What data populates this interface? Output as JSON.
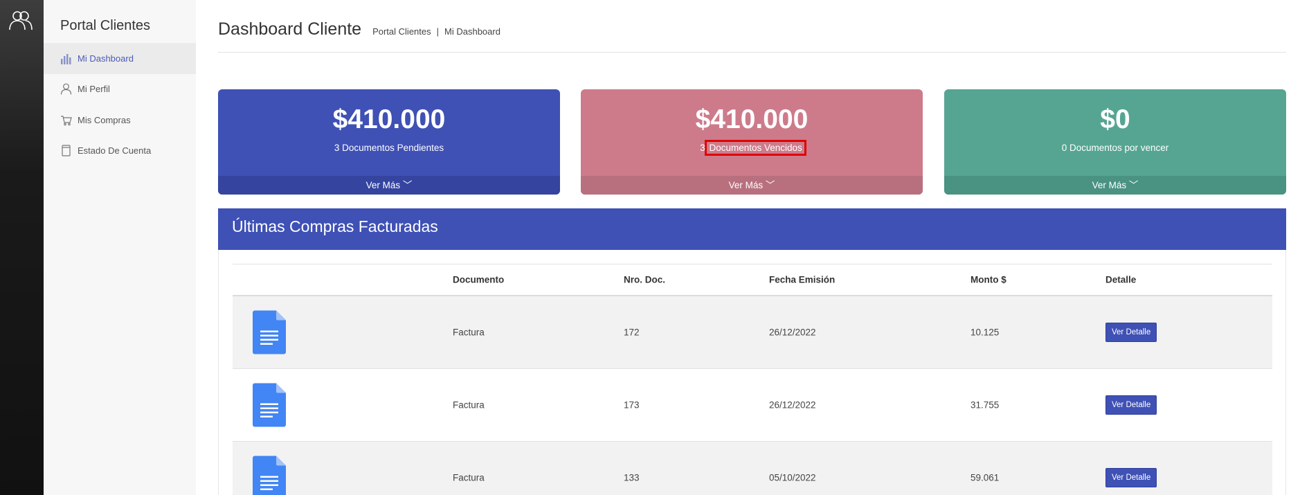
{
  "app": {
    "brand": "Portal Clientes"
  },
  "sidebar": {
    "items": [
      {
        "label": "Mi Dashboard",
        "icon": "bar-chart-icon",
        "active": true
      },
      {
        "label": "Mi Perfil",
        "icon": "user-icon"
      },
      {
        "label": "Mis Compras",
        "icon": "cart-icon"
      },
      {
        "label": "Estado De Cuenta",
        "icon": "document-icon"
      }
    ]
  },
  "header": {
    "title": "Dashboard Cliente",
    "breadcrumb": [
      "Portal Clientes",
      "Mi Dashboard"
    ]
  },
  "cards": [
    {
      "amount": "$410.000",
      "desc": "3 Documentos Pendientes",
      "more": "Ver Más ﹀",
      "color": "#3f51b5"
    },
    {
      "amount": "$410.000",
      "desc_num": "3",
      "desc_text": "Documentos Vencidos",
      "more": "Ver Más ﹀",
      "color": "#cd7b8b"
    },
    {
      "amount": "$0",
      "desc": "0 Documentos por vencer",
      "more": "Ver Más ﹀",
      "color": "#56a593"
    }
  ],
  "table": {
    "title": "Últimas Compras Facturadas",
    "columns": [
      "Documento",
      "Nro. Doc.",
      "Fecha Emisión",
      "Monto $",
      "Detalle"
    ],
    "rows": [
      {
        "doc": "Factura",
        "nro": "172",
        "fecha": "26/12/2022",
        "monto": "10.125",
        "detalle": "Ver Detalle"
      },
      {
        "doc": "Factura",
        "nro": "173",
        "fecha": "26/12/2022",
        "monto": "31.755",
        "detalle": "Ver Detalle"
      },
      {
        "doc": "Factura",
        "nro": "133",
        "fecha": "05/10/2022",
        "monto": "59.061",
        "detalle": "Ver Detalle"
      }
    ]
  },
  "colors": {
    "primary": "#3f51b5",
    "danger_soft": "#cd7b8b",
    "success_soft": "#56a593",
    "highlight": "#e00000"
  }
}
